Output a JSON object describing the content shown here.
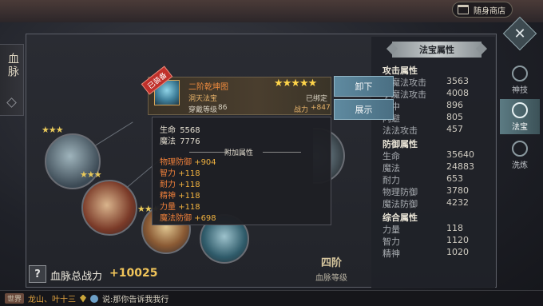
{
  "topbar": {
    "shop_label": "随身商店",
    "shop_icon": "shop-icon"
  },
  "left_tab": {
    "title": "血脉"
  },
  "side_tabs": [
    {
      "label": "神技",
      "active": false
    },
    {
      "label": "法宝",
      "active": true
    },
    {
      "label": "洗炼",
      "active": false
    }
  ],
  "item": {
    "badge": "已装备",
    "name": "二阶乾坤图",
    "type": "洞天法宝",
    "bound": "已绑定",
    "level_label": "穿戴等级",
    "level": "86",
    "power_label": "战力",
    "power": "+847",
    "stars": "★★★★★",
    "base": [
      {
        "name": "生命",
        "value": "5568"
      },
      {
        "name": "魔法",
        "value": "7776"
      }
    ],
    "bonus_title": "附加属性",
    "bonus": [
      {
        "name": "物理防御",
        "value": "+904"
      },
      {
        "name": "智力",
        "value": "+118"
      },
      {
        "name": "耐力",
        "value": "+118"
      },
      {
        "name": "精神",
        "value": "+118"
      },
      {
        "name": "力量",
        "value": "+118"
      },
      {
        "name": "魔法防御",
        "value": "+698"
      }
    ]
  },
  "actions": {
    "unequip": "卸下",
    "show": "展示"
  },
  "stats": {
    "header": "法宝属性",
    "attack_title": "攻击属性",
    "attack": [
      {
        "name": "大魔法攻击",
        "value": "3563"
      },
      {
        "name": "小魔法攻击",
        "value": "4008"
      },
      {
        "name": "命中",
        "value": "896"
      },
      {
        "name": "闪避",
        "value": "805"
      },
      {
        "name": "法法攻击",
        "value": "457"
      }
    ],
    "defense_title": "防御属性",
    "defense": [
      {
        "name": "生命",
        "value": "35640"
      },
      {
        "name": "魔法",
        "value": "24883"
      },
      {
        "name": "耐力",
        "value": "653"
      },
      {
        "name": "物理防御",
        "value": "3780"
      },
      {
        "name": "魔法防御",
        "value": "4232"
      }
    ],
    "general_title": "综合属性",
    "general": [
      {
        "name": "力量",
        "value": "118"
      },
      {
        "name": "智力",
        "value": "1120"
      },
      {
        "name": "精神",
        "value": "1020"
      }
    ]
  },
  "bottom": {
    "help": "?",
    "power_label": "血脉总战力",
    "power_value": "+10025",
    "rank": "四阶",
    "rank_label": "血脉等级"
  },
  "chat": {
    "channel": "世界",
    "name": "龙山、叶十三",
    "message": "说:那你告诉我我行"
  },
  "node_stars": [
    "★★★",
    "★★★",
    "★★★",
    "★★"
  ]
}
